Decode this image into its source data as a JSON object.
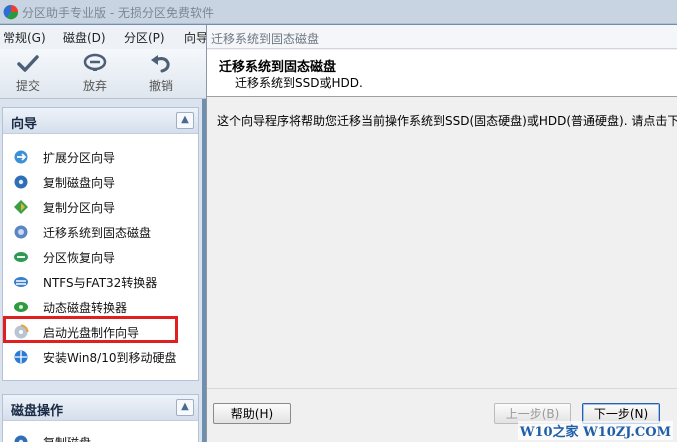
{
  "app": {
    "title": "分区助手专业版 - 无损分区免费软件"
  },
  "menu": {
    "items": [
      "常规(G)",
      "磁盘(D)",
      "分区(P)",
      "向导"
    ]
  },
  "toolbar": {
    "submit_label": "提交",
    "discard_label": "放弃",
    "undo_label": "撤销"
  },
  "wizard_panel": {
    "title": "向导",
    "items": [
      {
        "label": "扩展分区向导",
        "icon": "extend-partition-icon"
      },
      {
        "label": "复制磁盘向导",
        "icon": "copy-disk-icon"
      },
      {
        "label": "复制分区向导",
        "icon": "copy-partition-icon"
      },
      {
        "label": "迁移系统到固态磁盘",
        "icon": "migrate-os-icon"
      },
      {
        "label": "分区恢复向导",
        "icon": "partition-recovery-icon"
      },
      {
        "label": "NTFS与FAT32转换器",
        "icon": "ntfs-fat32-icon"
      },
      {
        "label": "动态磁盘转换器",
        "icon": "dynamic-disk-icon"
      },
      {
        "label": "启动光盘制作向导",
        "icon": "bootable-cd-icon"
      },
      {
        "label": "安装Win8/10到移动硬盘",
        "icon": "windows-to-go-icon"
      }
    ]
  },
  "disk_panel": {
    "title": "磁盘操作",
    "first_item": "复制磁盘"
  },
  "dialog": {
    "window_title": "迁移系统到固态磁盘",
    "heading": "迁移系统到固态磁盘",
    "subheading": "迁移系统到SSD或HDD.",
    "description": "这个向导程序将帮助您迁移当前操作系统到SSD(固态硬盘)或HDD(普通硬盘). 请点击下",
    "help_button": "帮助(H)",
    "prev_button": "上一步(B)",
    "next_button": "下一步(N)"
  },
  "watermark": "W10之家 W10ZJ.COM",
  "colors": {
    "highlight": "#e02020",
    "accent": "#1f5fa8"
  }
}
